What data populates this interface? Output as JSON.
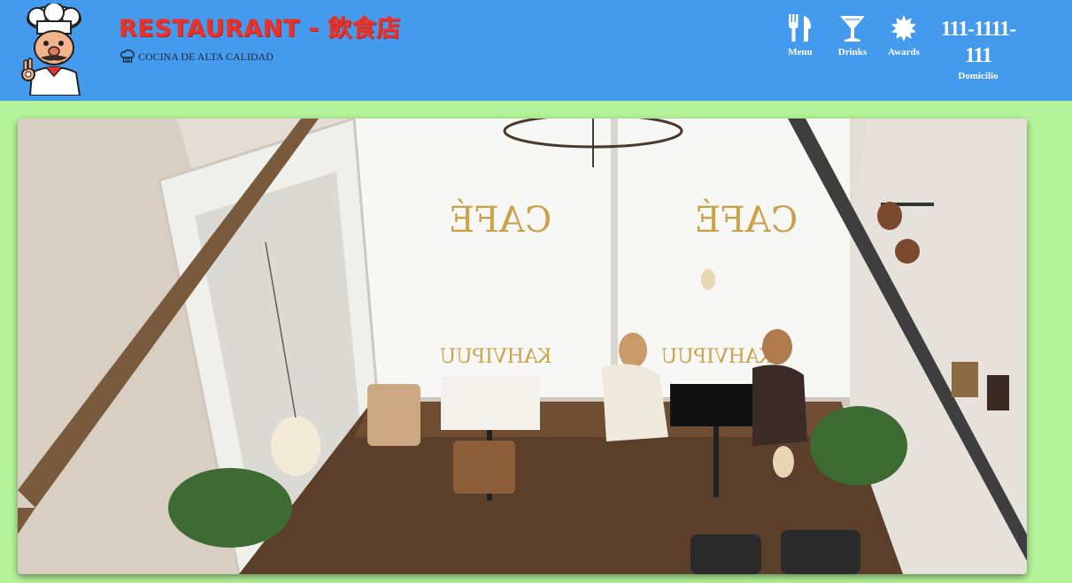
{
  "brand": {
    "title": "RESTAURANT - 飲食店",
    "tagline": "COCINA DE ALTA CALIDAD"
  },
  "nav": [
    {
      "label": "Menu",
      "icon": "cutlery-icon"
    },
    {
      "label": "Drinks",
      "icon": "cocktail-icon"
    },
    {
      "label": "Awards",
      "icon": "award-icon"
    }
  ],
  "contact": {
    "phone": "111-1111-111",
    "label": "Domicilio"
  },
  "hero": {
    "window_text_left": "CAFÉ",
    "window_text_right": "CAFÉ",
    "window_sign_left": "KAHVIPUU",
    "window_sign_right": "KAHVIPUU"
  },
  "colors": {
    "header": "#449bee",
    "page_background": "#b5f39a",
    "title": "#e8322a",
    "nav_text": "#ffffff"
  }
}
